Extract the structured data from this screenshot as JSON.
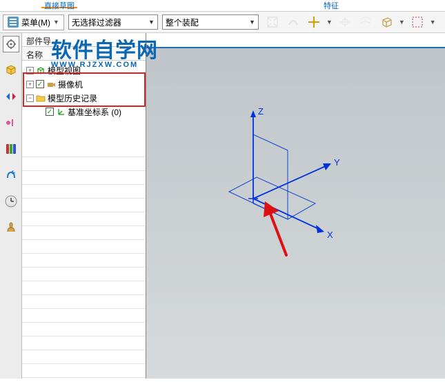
{
  "top_tabs": {
    "left": "直接草图",
    "right": "特征"
  },
  "menu": {
    "label": "菜单(M)"
  },
  "filters": {
    "selection_filter": "无选择过滤器",
    "assembly_scope": "整个装配"
  },
  "panel": {
    "header": "部件导",
    "name_col": "名称"
  },
  "tree": {
    "model_view": "模型视图",
    "camera": "摄像机",
    "history": "模型历史记录",
    "datum_csys": "基准坐标系 (0)"
  },
  "axes": {
    "x": "X",
    "y": "Y",
    "z": "Z"
  },
  "watermark": {
    "main": "软件自学网",
    "sub": "WWW.RJZXW.COM"
  }
}
